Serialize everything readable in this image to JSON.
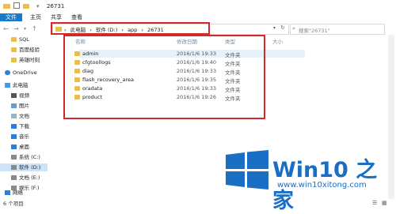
{
  "window": {
    "title": "26731"
  },
  "ribbon": {
    "tabs": [
      "文件",
      "主页",
      "共享",
      "查看"
    ]
  },
  "address": {
    "crumbs": [
      "此电脑",
      "软件 (D:)",
      "app",
      "26731"
    ],
    "separators": [
      "›",
      "›",
      "›",
      "›"
    ]
  },
  "search": {
    "placeholder": "搜索\"26731\""
  },
  "columns": {
    "name": "名称",
    "date": "修改日期",
    "type": "类型",
    "size": "大小"
  },
  "files": [
    {
      "name": "admin",
      "date": "2016/1/6 19:33",
      "type": "文件夹"
    },
    {
      "name": "cfgtoollogs",
      "date": "2016/1/6 19:40",
      "type": "文件夹"
    },
    {
      "name": "diag",
      "date": "2016/1/6 19:33",
      "type": "文件夹"
    },
    {
      "name": "flash_recovery_area",
      "date": "2016/1/6 19:35",
      "type": "文件夹"
    },
    {
      "name": "oradata",
      "date": "2016/1/6 19:33",
      "type": "文件夹"
    },
    {
      "name": "product",
      "date": "2016/1/6 19:26",
      "type": "文件夹"
    }
  ],
  "sidebar": {
    "items": [
      {
        "label": "SQL"
      },
      {
        "label": "百度经验"
      },
      {
        "label": "英雄时刻"
      },
      {
        "label": "OneDrive"
      },
      {
        "label": "此电脑"
      },
      {
        "label": "视频"
      },
      {
        "label": "图片"
      },
      {
        "label": "文档"
      },
      {
        "label": "下载"
      },
      {
        "label": "音乐"
      },
      {
        "label": "桌面"
      },
      {
        "label": "系统 (C:)"
      },
      {
        "label": "软件 (D:)"
      },
      {
        "label": "文档 (E:)"
      },
      {
        "label": "娱乐 (F:)"
      },
      {
        "label": "网络"
      }
    ]
  },
  "status": {
    "count": "6 个项目"
  },
  "watermark": {
    "brand": "Win10 之家",
    "url": "www.win10xitong.com"
  },
  "colors": {
    "accent": "#1979ca",
    "highlight": "#d12a2a",
    "folder": "#e8bf4c",
    "brand": "#1a6fc4"
  }
}
